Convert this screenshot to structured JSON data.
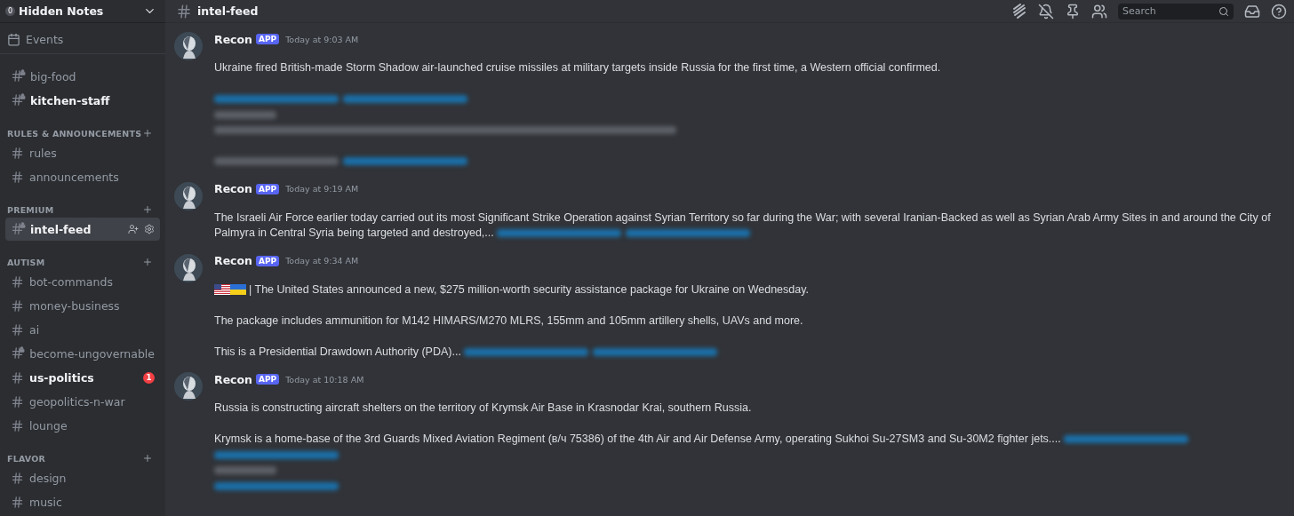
{
  "server": {
    "badge": "0",
    "name": "Hidden Notes"
  },
  "events": {
    "label": "Events"
  },
  "channels_top": [
    {
      "name": "big-food",
      "kind": "locked",
      "unread": false,
      "selected": false
    },
    {
      "name": "kitchen-staff",
      "kind": "locked",
      "unread": true,
      "selected": false
    }
  ],
  "categories": [
    {
      "name": "RULES & ANNOUNCEMENTS",
      "channels": [
        {
          "name": "rules",
          "kind": "text",
          "unread": false,
          "selected": false
        },
        {
          "name": "announcements",
          "kind": "text",
          "unread": false,
          "selected": false
        }
      ]
    },
    {
      "name": "PREMIUM",
      "channels": [
        {
          "name": "intel-feed",
          "kind": "locked",
          "unread": true,
          "selected": true
        }
      ]
    },
    {
      "name": "AUTISM",
      "channels": [
        {
          "name": "bot-commands",
          "kind": "text",
          "unread": false,
          "selected": false
        },
        {
          "name": "money-business",
          "kind": "text",
          "unread": false,
          "selected": false
        },
        {
          "name": "ai",
          "kind": "text",
          "unread": false,
          "selected": false
        },
        {
          "name": "become-ungovernable",
          "kind": "locked",
          "unread": false,
          "selected": false
        },
        {
          "name": "us-politics",
          "kind": "text",
          "unread": true,
          "selected": false,
          "mentions": "1"
        },
        {
          "name": "geopolitics-n-war",
          "kind": "text",
          "unread": false,
          "selected": false
        },
        {
          "name": "lounge",
          "kind": "text",
          "unread": false,
          "selected": false
        }
      ]
    },
    {
      "name": "FLAVOR",
      "channels": [
        {
          "name": "design",
          "kind": "text",
          "unread": false,
          "selected": false
        },
        {
          "name": "music",
          "kind": "text",
          "unread": false,
          "selected": false
        }
      ]
    }
  ],
  "header": {
    "channel": "intel-feed",
    "search": {
      "placeholder": "Search"
    }
  },
  "messages": [
    {
      "author": "Recon",
      "tag": "APP",
      "time": "Today at 9:03 AM",
      "lines": [
        {
          "kind": "text",
          "text": "Ukraine fired British-made Storm Shadow air-launched cruise missiles at military targets inside Russia for the first time, a Western official confirmed."
        },
        {
          "kind": "blank"
        },
        {
          "kind": "blurred",
          "parts": [
            {
              "kind": "link"
            },
            {
              "kind": "link"
            }
          ]
        },
        {
          "kind": "blurred",
          "parts": [
            {
              "kind": "short"
            }
          ]
        },
        {
          "kind": "blurred",
          "parts": [
            {
              "kind": "long"
            }
          ]
        },
        {
          "kind": "blank"
        },
        {
          "kind": "blurred",
          "parts": [
            {
              "kind": "text"
            },
            {
              "kind": "link"
            }
          ]
        }
      ]
    },
    {
      "author": "Recon",
      "tag": "APP",
      "time": "Today at 9:19 AM",
      "lines": [
        {
          "kind": "text",
          "text": "The Israeli Air Force earlier today carried out its most Significant Strike Operation against Syrian Territory so far during the War; with several Iranian-Backed as well as Syrian Arab Army Sites in and around the City of"
        },
        {
          "kind": "text",
          "text": "Palmyra in Central Syria being targeted and destroyed,...",
          "blurred": [
            {
              "kind": "link"
            },
            {
              "kind": "link"
            }
          ]
        }
      ]
    },
    {
      "author": "Recon",
      "tag": "APP",
      "time": "Today at 9:34 AM",
      "lines": [
        {
          "kind": "flags",
          "text": "| The United States announced a new, $275 million-worth security assistance package for Ukraine on Wednesday."
        },
        {
          "kind": "blank"
        },
        {
          "kind": "text",
          "text": "The package includes ammunition for M142 HIMARS/M270 MLRS, 155mm and 105mm artillery shells, UAVs and more."
        },
        {
          "kind": "blank"
        },
        {
          "kind": "text",
          "text": "This is a Presidential Drawdown Authority (PDA)...",
          "blurred": [
            {
              "kind": "link"
            },
            {
              "kind": "link"
            }
          ]
        }
      ]
    },
    {
      "author": "Recon",
      "tag": "APP",
      "time": "Today at 10:18 AM",
      "lines": [
        {
          "kind": "text",
          "text": "Russia is constructing aircraft shelters on the territory of Krymsk Air Base in Krasnodar Krai, southern Russia."
        },
        {
          "kind": "blank"
        },
        {
          "kind": "text",
          "text": "Krymsk is a home-base of the 3rd Guards Mixed Aviation Regiment (в/ч 75386) of the 4th Air and Air Defense Army, operating Sukhoi Su-27SM3 and Su-30M2 fighter jets....",
          "blurred": [
            {
              "kind": "link"
            }
          ]
        },
        {
          "kind": "blurred",
          "parts": [
            {
              "kind": "link"
            }
          ]
        },
        {
          "kind": "blurred",
          "parts": [
            {
              "kind": "short"
            }
          ]
        },
        {
          "kind": "blurred",
          "parts": [
            {
              "kind": "link"
            }
          ]
        }
      ]
    }
  ]
}
